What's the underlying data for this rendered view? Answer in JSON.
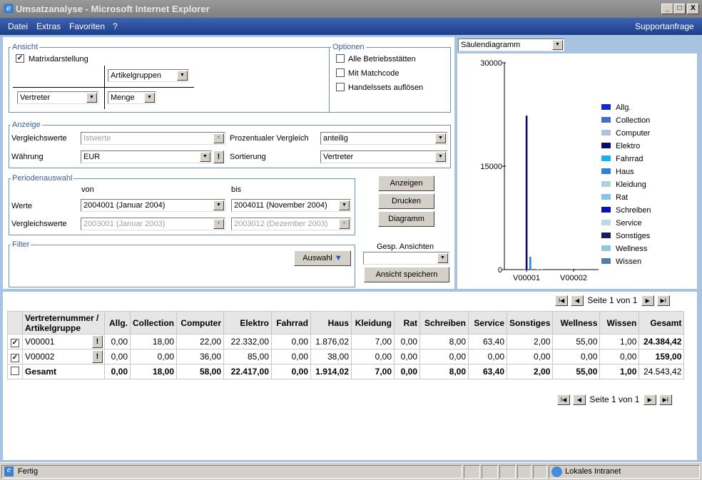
{
  "window": {
    "title": "Umsatzanalyse - Microsoft Internet Explorer",
    "min": "_",
    "max": "□",
    "close": "X"
  },
  "menu": {
    "items": [
      "Datei",
      "Extras",
      "Favoriten",
      "?"
    ],
    "support": "Supportanfrage"
  },
  "ansicht": {
    "legend": "Ansicht",
    "matrix_label": "Matrixdarstellung",
    "matrix_checked": true,
    "col_select": "Artikelgruppen",
    "row_select": "Vertreter",
    "value_select": "Menge"
  },
  "optionen": {
    "legend": "Optionen",
    "items": [
      {
        "label": "Alle Betriebsstätten",
        "checked": false
      },
      {
        "label": "Mit Matchcode",
        "checked": false
      },
      {
        "label": "Handelssets auflösen",
        "checked": false
      }
    ]
  },
  "anzeige": {
    "legend": "Anzeige",
    "vergleich_label": "Vergleichswerte",
    "vergleich_value": "Istwerte",
    "waehrung_label": "Währung",
    "waehrung_value": "EUR",
    "prozent_label": "Prozentualer Vergleich",
    "prozent_value": "anteilig",
    "sort_label": "Sortierung",
    "sort_value": "Vertreter",
    "info_btn": "!"
  },
  "periode": {
    "legend": "Periodenauswahl",
    "von": "von",
    "bis": "bis",
    "werte_label": "Werte",
    "werte_von": "2004001 (Januar 2004)",
    "werte_bis": "2004011 (November 2004)",
    "vergl_label": "Vergleichswerte",
    "vergl_von": "2003001 (Januar 2003)",
    "vergl_bis": "2003012 (Dezember 2003)"
  },
  "buttons": {
    "anzeigen": "Anzeigen",
    "drucken": "Drucken",
    "diagramm": "Diagramm",
    "auswahl": "Auswahl",
    "ansicht_speichern": "Ansicht speichern"
  },
  "filter": {
    "legend": "Filter"
  },
  "gesp": {
    "label": "Gesp. Ansichten",
    "value": ""
  },
  "chart_select": "Säulendiagramm",
  "chart_data": {
    "type": "bar",
    "categories": [
      "V00001",
      "V00002"
    ],
    "yticks": [
      "0",
      "15000",
      "30000"
    ],
    "ylim": [
      0,
      30000
    ],
    "legend_position": "right",
    "series": [
      {
        "name": "Allg.",
        "color": "#1428d0",
        "values": [
          0,
          0
        ]
      },
      {
        "name": "Collection",
        "color": "#4a6ad0",
        "values": [
          18,
          0
        ]
      },
      {
        "name": "Computer",
        "color": "#b0c0dc",
        "values": [
          22,
          36
        ]
      },
      {
        "name": "Elektro",
        "color": "#0a0a6a",
        "values": [
          22332,
          85
        ]
      },
      {
        "name": "Fahrrad",
        "color": "#20b0e8",
        "values": [
          0,
          0
        ]
      },
      {
        "name": "Haus",
        "color": "#3080e0",
        "values": [
          1876.02,
          38
        ]
      },
      {
        "name": "Kleidung",
        "color": "#b0d0dc",
        "values": [
          7,
          0
        ]
      },
      {
        "name": "Rat",
        "color": "#8cc0e8",
        "values": [
          0,
          0
        ]
      },
      {
        "name": "Schreiben",
        "color": "#1010b0",
        "values": [
          8,
          0
        ]
      },
      {
        "name": "Service",
        "color": "#b8dce4",
        "values": [
          63.4,
          0
        ]
      },
      {
        "name": "Sonstiges",
        "color": "#1c1c5c",
        "values": [
          2,
          0
        ]
      },
      {
        "name": "Wellness",
        "color": "#90c8e0",
        "values": [
          55,
          0
        ]
      },
      {
        "name": "Wissen",
        "color": "#5080a8",
        "values": [
          1,
          0
        ]
      }
    ]
  },
  "pager": {
    "text": "Seite 1 von 1",
    "first": "I◀",
    "prev": "◀",
    "next": "▶",
    "last": "▶I"
  },
  "table": {
    "header": [
      "Vertreternummer / Artikelgruppe",
      "Allg.",
      "Collection",
      "Computer",
      "Elektro",
      "Fahrrad",
      "Haus",
      "Kleidung",
      "Rat",
      "Schreiben",
      "Service",
      "Sonstiges",
      "Wellness",
      "Wissen",
      "Gesamt"
    ],
    "rows": [
      {
        "checked": true,
        "name": "V00001",
        "cells": [
          "0,00",
          "18,00",
          "22,00",
          "22.332,00",
          "0,00",
          "1.876,02",
          "7,00",
          "0,00",
          "8,00",
          "63,40",
          "2,00",
          "55,00",
          "1,00"
        ],
        "total": "24.384,42"
      },
      {
        "checked": true,
        "name": "V00002",
        "cells": [
          "0,00",
          "0,00",
          "36,00",
          "85,00",
          "0,00",
          "38,00",
          "0,00",
          "0,00",
          "0,00",
          "0,00",
          "0,00",
          "0,00",
          "0,00"
        ],
        "total": "159,00"
      },
      {
        "checked": false,
        "name": "Gesamt",
        "cells": [
          "0,00",
          "18,00",
          "58,00",
          "22.417,00",
          "0,00",
          "1.914,02",
          "7,00",
          "0,00",
          "8,00",
          "63,40",
          "2,00",
          "55,00",
          "1,00"
        ],
        "total": "24.543,42"
      }
    ]
  },
  "status": {
    "text": "Fertig",
    "zone": "Lokales Intranet"
  }
}
